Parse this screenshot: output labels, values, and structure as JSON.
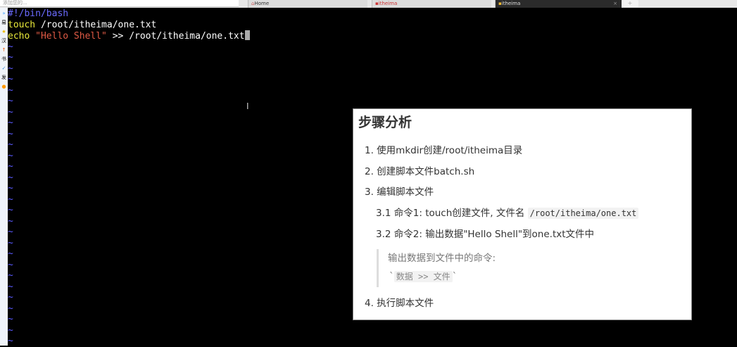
{
  "browser": {
    "address_placeholder": "添加您的...",
    "tabs": [
      {
        "label": "Home",
        "icon": "home-icon"
      },
      {
        "label": "itheima",
        "icon": "terminal-icon"
      },
      {
        "label": "itheima",
        "icon": "terminal-icon",
        "active": true
      }
    ],
    "close": "×",
    "new_tab": "+"
  },
  "sidebar": {
    "items": [
      "»",
      "易",
      "★",
      "汉",
      "↑",
      "书",
      "✓",
      "发",
      "●"
    ]
  },
  "editor": {
    "shebang": "#!/bin/bash",
    "line2_cmd": "touch",
    "line2_arg": " /root/itheima/one.txt",
    "line3_cmd": "echo",
    "line3_str": "\"Hello Shell\"",
    "line3_rest": " >> /root/itheima/one.txt",
    "tilde": "~",
    "ibeam": "I"
  },
  "panel": {
    "title": "步骤分析",
    "steps": [
      "1. 使用mkdir创建/root/itheima目录",
      "2. 创建脚本文件batch.sh",
      "3. 编辑脚本文件"
    ],
    "sub1_text": "3.1 命令1: touch创建文件, 文件名 ",
    "sub1_code": "/root/itheima/one.txt",
    "sub2": "3.2 命令2: 输出数据\"Hello Shell\"到one.txt文件中",
    "quote_text": "输出数据到文件中的命令:",
    "quote_tick": "`",
    "quote_code": "数据 >> 文件",
    "step4": "4. 执行脚本文件"
  }
}
